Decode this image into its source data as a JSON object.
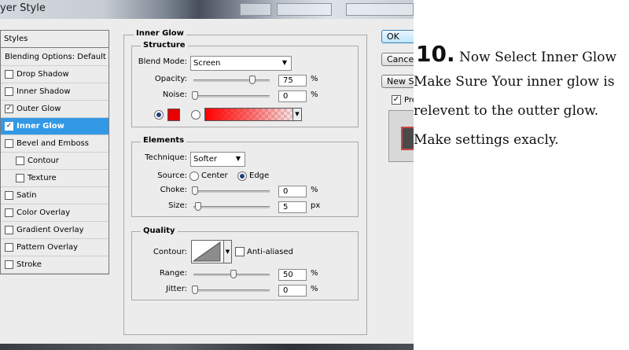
{
  "window": {
    "title": "yer Style"
  },
  "styles_list": {
    "header": "Styles",
    "items": [
      {
        "label": "Blending Options: Default",
        "checkbox": false,
        "checked": false,
        "selected": false
      },
      {
        "label": "Drop Shadow",
        "checkbox": true,
        "checked": false,
        "selected": false
      },
      {
        "label": "Inner Shadow",
        "checkbox": true,
        "checked": false,
        "selected": false
      },
      {
        "label": "Outer Glow",
        "checkbox": true,
        "checked": true,
        "selected": false
      },
      {
        "label": "Inner Glow",
        "checkbox": true,
        "checked": true,
        "selected": true
      },
      {
        "label": "Bevel and Emboss",
        "checkbox": true,
        "checked": false,
        "selected": false
      },
      {
        "label": "Contour",
        "checkbox": true,
        "checked": false,
        "selected": false,
        "indent": true
      },
      {
        "label": "Texture",
        "checkbox": true,
        "checked": false,
        "selected": false,
        "indent": true
      },
      {
        "label": "Satin",
        "checkbox": true,
        "checked": false,
        "selected": false
      },
      {
        "label": "Color Overlay",
        "checkbox": true,
        "checked": false,
        "selected": false
      },
      {
        "label": "Gradient Overlay",
        "checkbox": true,
        "checked": false,
        "selected": false
      },
      {
        "label": "Pattern Overlay",
        "checkbox": true,
        "checked": false,
        "selected": false
      },
      {
        "label": "Stroke",
        "checkbox": true,
        "checked": false,
        "selected": false
      }
    ],
    "check_mark": "✓"
  },
  "inner_glow": {
    "title": "Inner Glow",
    "structure": {
      "title": "Structure",
      "blend_mode_label": "Blend Mode:",
      "blend_mode_value": "Screen",
      "opacity_label": "Opacity:",
      "opacity_value": "75",
      "opacity_unit": "%",
      "opacity_fraction": 0.75,
      "noise_label": "Noise:",
      "noise_value": "0",
      "noise_unit": "%",
      "noise_fraction": 0,
      "color_mode": "solid",
      "glow_color": "#e60000"
    },
    "elements": {
      "title": "Elements",
      "technique_label": "Technique:",
      "technique_value": "Softer",
      "source_label": "Source:",
      "source_center": "Center",
      "source_edge": "Edge",
      "source_selected": "Edge",
      "choke_label": "Choke:",
      "choke_value": "0",
      "choke_unit": "%",
      "size_label": "Size:",
      "size_value": "5",
      "size_unit": "px"
    },
    "quality": {
      "title": "Quality",
      "contour_label": "Contour:",
      "anti_aliased_label": "Anti-aliased",
      "anti_aliased": false,
      "range_label": "Range:",
      "range_value": "50",
      "range_unit": "%",
      "range_fraction": 0.5,
      "jitter_label": "Jitter:",
      "jitter_value": "0",
      "jitter_unit": "%",
      "jitter_fraction": 0
    }
  },
  "buttons": {
    "ok": "OK",
    "cancel": "Cancel",
    "new_style": "New Style...",
    "preview_label": "Preview",
    "preview_checked": true
  },
  "instructions": {
    "step_number": "10.",
    "line1": "Now Select Inner Glow",
    "line2": "Make Sure Your inner glow is",
    "line3": "relevent to the outter glow.",
    "line4": "Make settings exacly."
  },
  "icons": {
    "dropdown": "triangle-down-icon",
    "check": "checkmark-icon",
    "contour": "contour-linear-icon"
  }
}
